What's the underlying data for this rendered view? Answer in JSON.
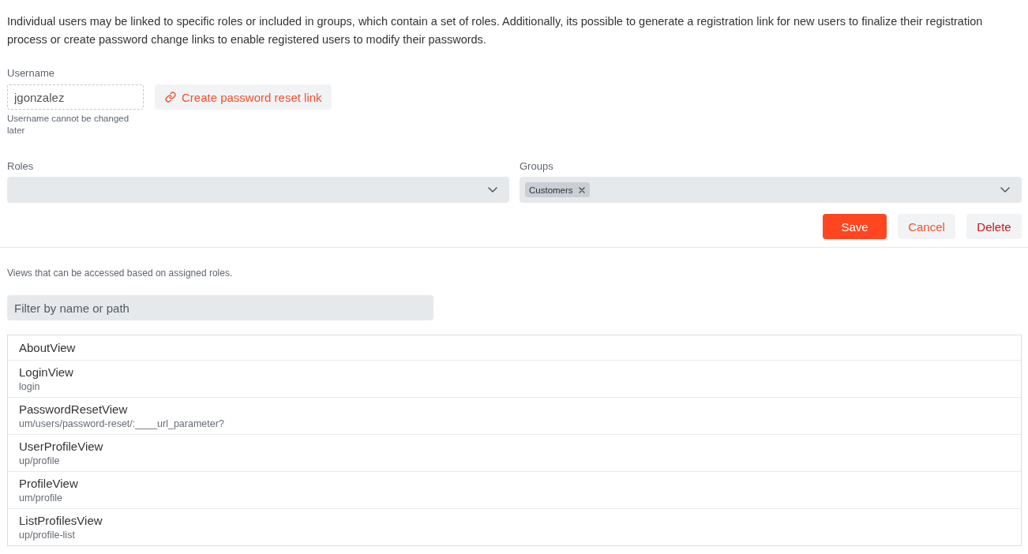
{
  "description": "Individual users may be linked to specific roles or included in groups, which contain a set of roles. Additionally, its possible to generate a registration link for new users to finalize their registration process or create password change links to enable registered users to modify their passwords.",
  "username": {
    "label": "Username",
    "value": "jgonzalez",
    "readonly": true,
    "hint": "Username cannot be changed later"
  },
  "reset_link_button": {
    "label": "Create password reset link"
  },
  "roles": {
    "label": "Roles"
  },
  "groups": {
    "label": "Groups",
    "selections": [
      "Customers"
    ]
  },
  "actions": [
    {
      "label": "Save",
      "kind": "primary"
    },
    {
      "label": "Cancel",
      "kind": "secondary"
    },
    {
      "label": "Delete",
      "kind": "danger"
    }
  ],
  "views_caption": "Views that can be accessed based on assigned roles.",
  "filter": {
    "placeholder": "Filter by name or path"
  },
  "views": [
    {
      "name": "AboutView"
    },
    {
      "name": "LoginView",
      "path": "login"
    },
    {
      "name": "PasswordResetView",
      "path": "um/users/password-reset/:____url_parameter?"
    },
    {
      "name": "UserProfileView",
      "path": "up/profile"
    },
    {
      "name": "ProfileView",
      "path": "um/profile"
    },
    {
      "name": "ListProfilesView",
      "path": "up/profile-list"
    }
  ]
}
